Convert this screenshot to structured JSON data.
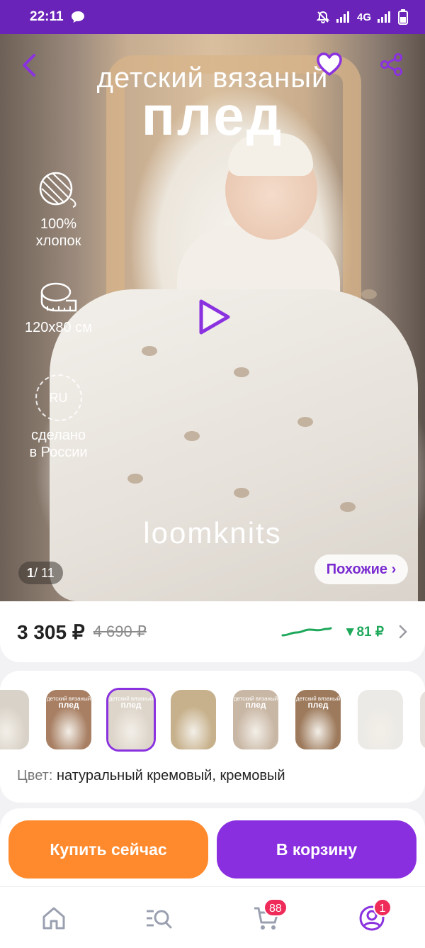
{
  "status_bar": {
    "time": "22:11",
    "network": "4G"
  },
  "hero": {
    "subtitle": "детский вязаный",
    "title": "плед",
    "features": [
      {
        "icon": "yarn-ball-icon",
        "line1": "100%",
        "line2": "хлопок"
      },
      {
        "icon": "measuring-tape-icon",
        "line1": "120х80 см",
        "line2": ""
      },
      {
        "icon": "ru-badge-icon",
        "badge": "RU",
        "line1": "сделано",
        "line2": "в России"
      }
    ],
    "brand": "loomknits",
    "counter_current": "1",
    "counter_total": "/ 11",
    "similar_label": "Похожие ›"
  },
  "price": {
    "current": "3 305 ₽",
    "old": "4 690 ₽",
    "drop": "▼81 ₽",
    "trend_color": "#1ea85a"
  },
  "colors": {
    "label": "Цвет:",
    "value": "натуральный кремовый, кремовый",
    "thumbnails": [
      {
        "tone": "#d9d2c8",
        "title": "",
        "sub": ""
      },
      {
        "tone": "#a87f63",
        "title": "плед",
        "sub": "детский вязаный"
      },
      {
        "tone": "#ddd5ca",
        "title": "плед",
        "sub": "детский вязаный",
        "selected": true
      },
      {
        "tone": "#c7b18c",
        "title": "",
        "sub": ""
      },
      {
        "tone": "#c9b7a5",
        "title": "плед",
        "sub": "детский вязаный"
      },
      {
        "tone": "#9d7a5c",
        "title": "плед",
        "sub": "детский вязаный"
      },
      {
        "tone": "#eceae6",
        "title": "",
        "sub": ""
      },
      {
        "tone": "#e6e1dc",
        "title": "",
        "sub": ""
      }
    ]
  },
  "actions": {
    "buy_now": "Купить сейчас",
    "add_to_cart": "В корзину"
  },
  "nav": {
    "cart_badge": "88",
    "profile_badge": "1"
  },
  "colors_theme": {
    "accent": "#8a2fe0",
    "buy": "#ff8a2e",
    "status": "#6a23b8"
  }
}
